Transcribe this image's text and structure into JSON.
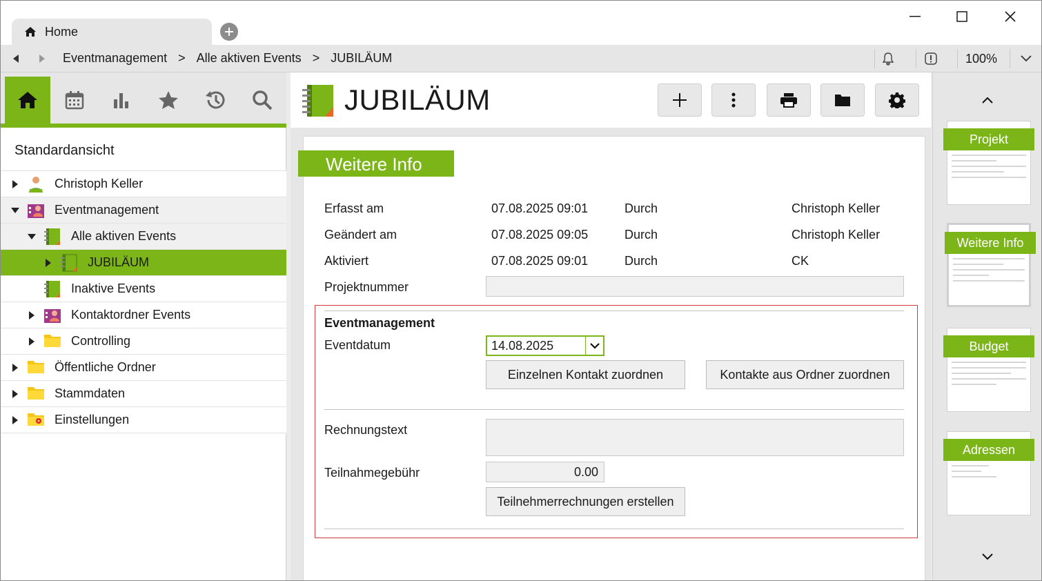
{
  "window": {
    "tab_label": "Home",
    "zoom": "100%"
  },
  "breadcrumb": [
    "Eventmanagement",
    ">",
    "Alle aktiven Events",
    ">",
    "JUBILÄUM"
  ],
  "sidebar": {
    "view_title": "Standardansicht",
    "tree": [
      {
        "label": "Christoph Keller",
        "expanded": false
      },
      {
        "label": "Eventmanagement",
        "expanded": true
      },
      {
        "label": "Alle aktiven Events",
        "expanded": true
      },
      {
        "label": "JUBILÄUM",
        "expanded": false,
        "selected": true
      },
      {
        "label": "Inaktive Events",
        "expanded": false
      },
      {
        "label": "Kontaktordner Events",
        "expanded": false
      },
      {
        "label": "Controlling",
        "expanded": false
      },
      {
        "label": "Öffentliche Ordner",
        "expanded": false
      },
      {
        "label": "Stammdaten",
        "expanded": false
      },
      {
        "label": "Einstellungen",
        "expanded": false
      }
    ]
  },
  "main": {
    "title": "JUBILÄUM",
    "section_title": "Weitere Info",
    "meta": [
      {
        "label": "Erfasst am",
        "date": "07.08.2025 09:01",
        "by_label": "Durch",
        "by": "Christoph Keller"
      },
      {
        "label": "Geändert am",
        "date": "07.08.2025 09:05",
        "by_label": "Durch",
        "by": "Christoph Keller"
      },
      {
        "label": "Aktiviert",
        "date": "07.08.2025 09:01",
        "by_label": "Durch",
        "by": "CK"
      }
    ],
    "projektnummer_label": "Projektnummer",
    "projektnummer_value": "",
    "event_section": {
      "heading": "Eventmanagement",
      "eventdatum_label": "Eventdatum",
      "eventdatum_value": "14.08.2025",
      "btn_einzeln": "Einzelnen Kontakt zuordnen",
      "btn_ordner": "Kontakte aus Ordner zuordnen",
      "rechnungstext_label": "Rechnungstext",
      "rechnungstext_value": "",
      "gebuehr_label": "Teilnahmegebühr",
      "gebuehr_value": "0.00",
      "btn_rechnungen": "Teilnehmerrechnungen erstellen"
    }
  },
  "thumbnails": [
    "Projekt",
    "Weitere Info",
    "Budget",
    "Adressen"
  ],
  "colors": {
    "accent": "#7cb518",
    "highlight_border": "#d33a3a"
  }
}
